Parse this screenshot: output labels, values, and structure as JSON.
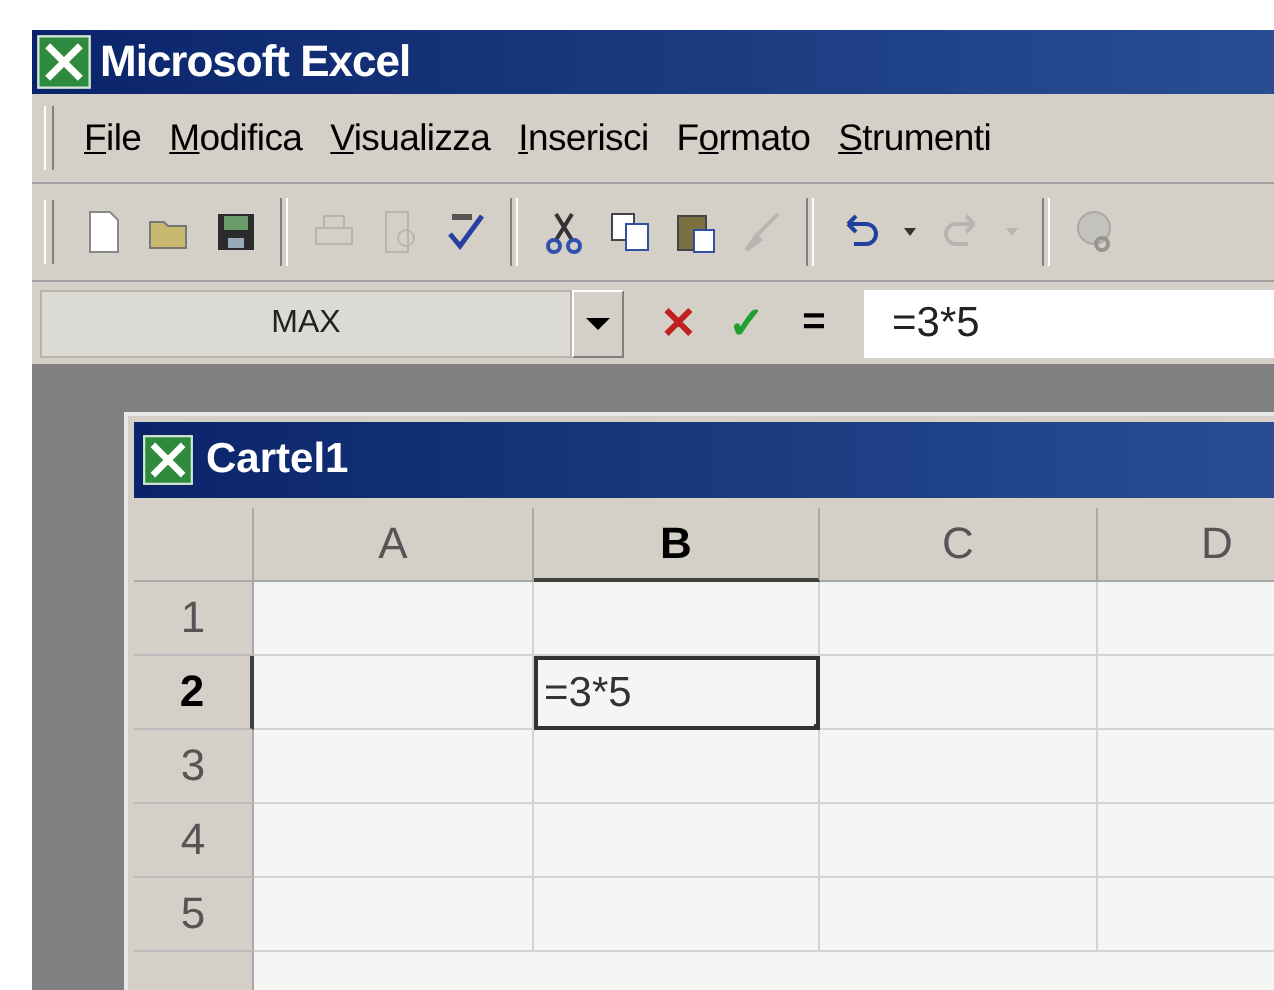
{
  "window": {
    "title": "Microsoft Excel"
  },
  "menu": [
    {
      "key": "F",
      "post": "ile"
    },
    {
      "key": "M",
      "post": "odifica"
    },
    {
      "key": "V",
      "post": "isualizza"
    },
    {
      "key": "I",
      "post": "nserisci"
    },
    {
      "pre": "F",
      "key": "o",
      "post": "rmato"
    },
    {
      "key": "S",
      "post": "trumenti"
    }
  ],
  "toolbar": [
    {
      "kind": "new",
      "disabled": false
    },
    {
      "kind": "open",
      "disabled": false
    },
    {
      "kind": "save",
      "disabled": false
    },
    {
      "kind": "separator"
    },
    {
      "kind": "print",
      "disabled": true
    },
    {
      "kind": "preview",
      "disabled": true
    },
    {
      "kind": "spelling",
      "disabled": false
    },
    {
      "kind": "separator"
    },
    {
      "kind": "cut",
      "disabled": false
    },
    {
      "kind": "copy",
      "disabled": false
    },
    {
      "kind": "paste",
      "disabled": false
    },
    {
      "kind": "painter",
      "disabled": true
    },
    {
      "kind": "separator"
    },
    {
      "kind": "undo",
      "disabled": false
    },
    {
      "kind": "dropdown",
      "disabled": false
    },
    {
      "kind": "redo",
      "disabled": true
    },
    {
      "kind": "dropdown",
      "disabled": true
    },
    {
      "kind": "separator"
    },
    {
      "kind": "hyperlink",
      "disabled": true
    }
  ],
  "formula_bar": {
    "name_box": "MAX",
    "cancel": "✕",
    "enter": "✓",
    "equals": "=",
    "value": "=3*5"
  },
  "workbook": {
    "title": "Cartel1",
    "columns": [
      {
        "label": "A",
        "selected": false
      },
      {
        "label": "B",
        "selected": true
      },
      {
        "label": "C",
        "selected": false
      },
      {
        "label": "D",
        "selected": false
      }
    ],
    "rows": [
      {
        "label": "1",
        "selected": false,
        "cells": [
          {
            "active": false
          },
          {
            "active": false
          },
          {
            "active": false
          },
          {
            "active": false
          }
        ]
      },
      {
        "label": "2",
        "selected": true,
        "cells": [
          {
            "active": false
          },
          {
            "value": "=3*5",
            "active": true
          },
          {
            "active": false
          },
          {
            "active": false
          }
        ]
      },
      {
        "label": "3",
        "selected": false,
        "cells": [
          {
            "active": false
          },
          {
            "active": false
          },
          {
            "active": false
          },
          {
            "active": false
          }
        ]
      },
      {
        "label": "4",
        "selected": false,
        "cells": [
          {
            "active": false
          },
          {
            "active": false
          },
          {
            "active": false
          },
          {
            "active": false
          }
        ]
      },
      {
        "label": "5",
        "selected": false,
        "cells": [
          {
            "active": false
          },
          {
            "active": false
          },
          {
            "active": false
          },
          {
            "active": false
          }
        ]
      }
    ]
  }
}
